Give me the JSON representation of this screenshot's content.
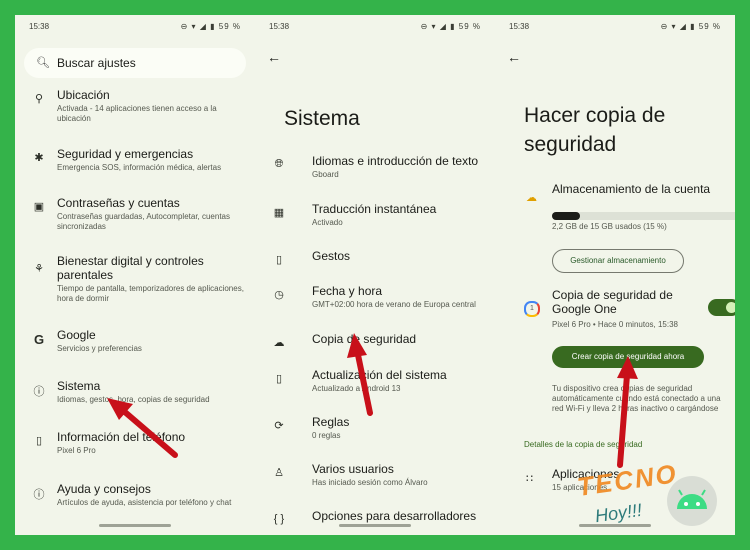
{
  "screen1": {
    "time": "15:38",
    "status_icons": "⊖ ▾ ◢ ▮ 59 %",
    "search_placeholder": "Buscar ajustes",
    "items": [
      {
        "title": "Ubicación",
        "subtitle": "Activada - 14 aplicaciones tienen acceso a la ubicación",
        "icon": "location-icon"
      },
      {
        "title": "Seguridad y emergencias",
        "subtitle": "Emergencia SOS, información médica, alertas",
        "icon": "emergency-icon"
      },
      {
        "title": "Contraseñas y cuentas",
        "subtitle": "Contraseñas guardadas, Autocompletar, cuentas sincronizadas",
        "icon": "account-box-icon"
      },
      {
        "title": "Bienestar digital y controles parentales",
        "subtitle": "Tiempo de pantalla, temporizadores de aplicaciones, hora de dormir",
        "icon": "wellbeing-icon"
      },
      {
        "title": "Google",
        "subtitle": "Servicios y preferencias",
        "icon": "google-icon"
      },
      {
        "title": "Sistema",
        "subtitle": "Idiomas, gestos, hora, copias de seguridad",
        "icon": "info-icon"
      },
      {
        "title": "Información del teléfono",
        "subtitle": "Pixel 6 Pro",
        "icon": "phone-icon"
      },
      {
        "title": "Ayuda y consejos",
        "subtitle": "Artículos de ayuda, asistencia por teléfono y chat",
        "icon": "help-icon"
      }
    ]
  },
  "screen2": {
    "time": "15:38",
    "status_icons": "⊖ ▾ ◢ ▮ 59 %",
    "title": "Sistema",
    "items": [
      {
        "title": "Idiomas e introducción de texto",
        "subtitle": "Gboard",
        "icon": "globe-icon"
      },
      {
        "title": "Traducción instantánea",
        "subtitle": "Activado",
        "icon": "translate-icon"
      },
      {
        "title": "Gestos",
        "subtitle": "",
        "icon": "gestures-icon"
      },
      {
        "title": "Fecha y hora",
        "subtitle": "GMT+02:00 hora de verano de Europa central",
        "icon": "clock-icon"
      },
      {
        "title": "Copia de seguridad",
        "subtitle": "",
        "icon": "cloud-upload-icon"
      },
      {
        "title": "Actualización del sistema",
        "subtitle": "Actualizado a Android 13",
        "icon": "system-update-icon"
      },
      {
        "title": "Reglas",
        "subtitle": "0 reglas",
        "icon": "rules-icon"
      },
      {
        "title": "Varios usuarios",
        "subtitle": "Has iniciado sesión como Álvaro",
        "icon": "users-icon"
      },
      {
        "title": "Opciones para desarrolladores",
        "subtitle": "",
        "icon": "code-braces-icon"
      }
    ]
  },
  "screen3": {
    "time": "15:38",
    "status_icons": "⊖ ▾ ◢ ▮ 59 %",
    "title_line1": "Hacer copia de",
    "title_line2": "seguridad",
    "storage_title": "Almacenamiento de la cuenta",
    "storage_fraction": 0.15,
    "storage_text": "2,2 GB de 15 GB usados (15 %)",
    "manage_button": "Gestionar almacenamiento",
    "backup_title": "Copia de seguridad de Google One",
    "backup_subtitle": "Pixel 6 Pro • Hace 0 minutos, 15:38",
    "backup_now_button": "Crear copia de seguridad ahora",
    "description": "Tu dispositivo crea copias de seguridad automáticamente cuando está conectado a una red Wi-Fi y lleva 2 horas inactivo o cargándose",
    "details_header": "Detalles de la copia de seguridad",
    "apps_label": "Aplicaciones",
    "apps_sub": "15 aplicaciones"
  },
  "watermark": {
    "line1": "TECNO",
    "line2": "Hoy!!!"
  },
  "colors": {
    "frame": "#34b34a",
    "accent": "#386a20",
    "arrow": "#c8101a",
    "background": "#f2f5ea"
  }
}
